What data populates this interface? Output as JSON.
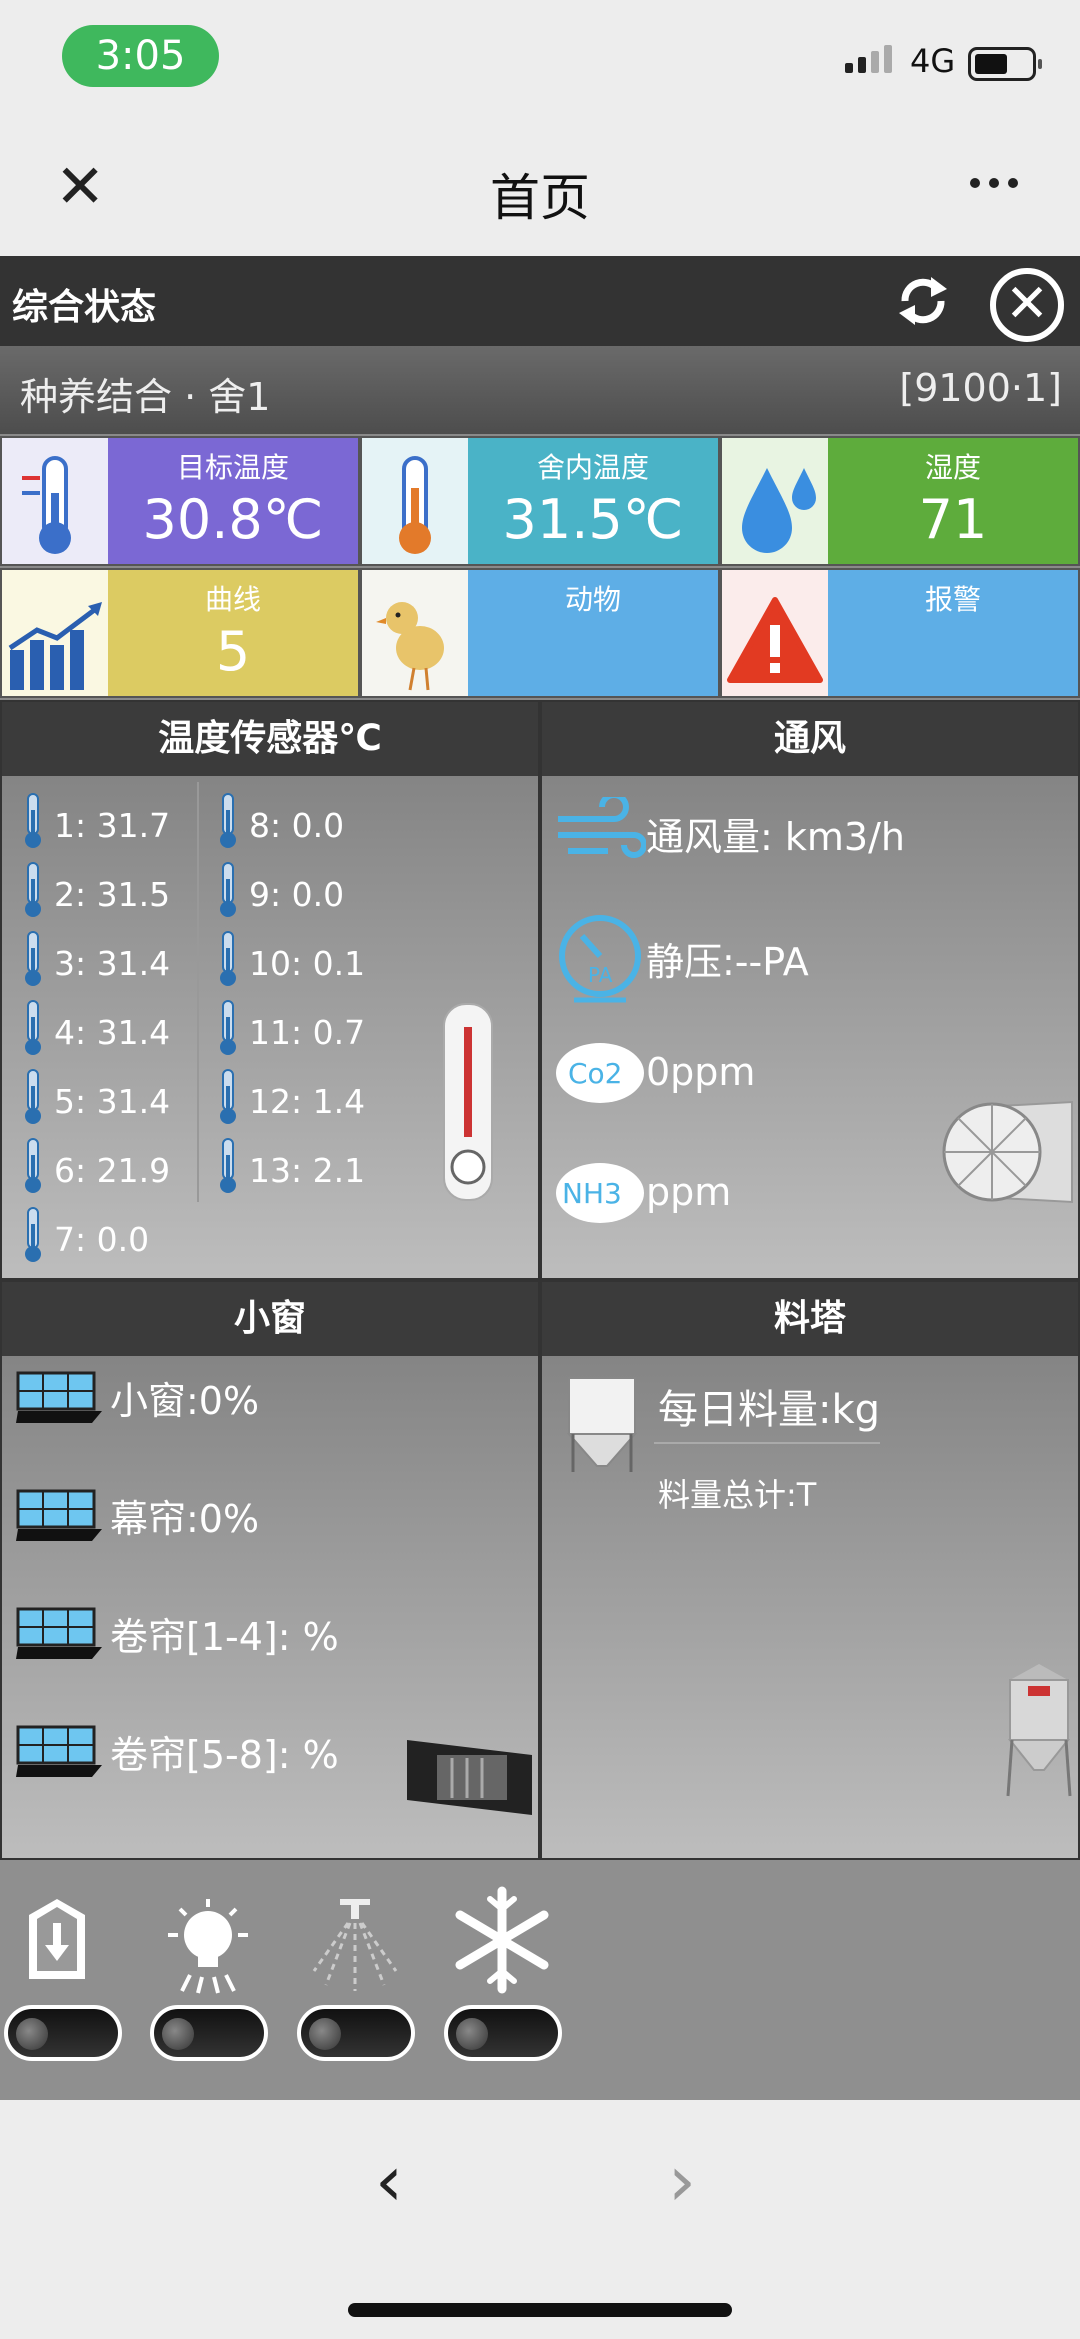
{
  "status_bar": {
    "time": "3:05",
    "network": "4G"
  },
  "nav": {
    "title": "首页",
    "close_glyph": "✕"
  },
  "header": {
    "title": "综合状态"
  },
  "farm": {
    "name": "种养结合 · 舍1",
    "code": "[9100·1]"
  },
  "tiles": {
    "target_temp": {
      "label": "目标温度",
      "value": "30.8℃",
      "color": "#7b68d4"
    },
    "indoor_temp": {
      "label": "舍内温度",
      "value": "31.5℃",
      "color": "#4ab3c7"
    },
    "humidity": {
      "label": "湿度",
      "value": "71",
      "color": "#5eac3c"
    },
    "curve": {
      "label": "曲线",
      "value": "5",
      "color": "#dccb62"
    },
    "animal": {
      "label": "动物",
      "value": "",
      "color": "#5eaee6"
    },
    "alarm": {
      "label": "报警",
      "value": "",
      "color": "#5eaee6"
    }
  },
  "temp_sensors": {
    "title": "温度传感器℃",
    "left": [
      "1: 31.7",
      "2: 31.5",
      "3: 31.4",
      "4: 31.4",
      "5: 31.4",
      "6: 21.9",
      "7: 0.0"
    ],
    "right": [
      "8: 0.0",
      "9: 0.0",
      "10: 0.1",
      "11: 0.7",
      "12: 1.4",
      "13: 2.1"
    ]
  },
  "ventilation": {
    "title": "通风",
    "airflow": "通风量: km3/h",
    "pressure": "静压:--PA",
    "pressure_badge": "PA",
    "co2": "0ppm",
    "co2_badge": "Co2",
    "nh3": "ppm",
    "nh3_badge": "NH3"
  },
  "windows": {
    "title": "小窗",
    "items": [
      "小窗:0%",
      "幕帘:0%",
      "卷帘[1-4]: %",
      "卷帘[5-8]: %"
    ]
  },
  "feed_tower": {
    "title": "料塔",
    "daily": "每日料量:kg",
    "total": "料量总计:T"
  },
  "controls": [
    "feeder-icon",
    "light-bulb-icon",
    "sprinkler-icon",
    "snowflake-icon"
  ],
  "browser": {
    "back": "‹",
    "forward": "›"
  }
}
